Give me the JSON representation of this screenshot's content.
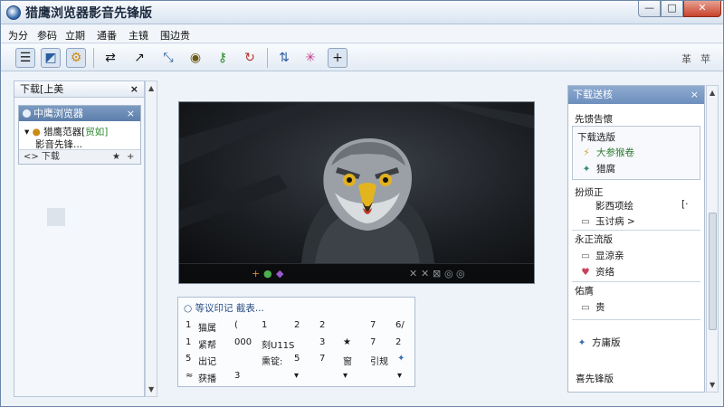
{
  "window": {
    "title": "猎鹰浏览器影音先锋版",
    "min": "—",
    "max": "□",
    "close": "✕"
  },
  "menu": [
    "为分",
    "参码",
    "立期",
    "通番",
    "主镜",
    "围边贵"
  ],
  "toolbar": {
    "icons": [
      "list-icon",
      "palette-icon",
      "folder-icon",
      "swap-icon",
      "line-icon",
      "resize-icon",
      "helmet-icon",
      "key-icon",
      "refresh-icon",
      "tools-icon",
      "star-burst-icon",
      "add-icon"
    ],
    "right_labels": [
      "革",
      "苹"
    ]
  },
  "left_panel": {
    "title": "下载[上美",
    "subpanel_title": "中鹰浏览器",
    "tree_root": "猎鹰范器[",
    "tree_root_suffix": "贸如]",
    "tree_child": "影音先锋...",
    "footer_label": "<> 下载",
    "footer_icons": [
      "★",
      "+"
    ]
  },
  "video": {
    "control_icons_left": [
      "+",
      "●",
      "◆"
    ],
    "control_icons_right": [
      "✕",
      "✕",
      "⊠",
      "◎",
      "◎"
    ]
  },
  "info_box": {
    "header": "○  等议印记    截表...",
    "rows": [
      [
        "1",
        "猫属",
        "(",
        "1",
        "2",
        "2",
        "",
        "7",
        "6/"
      ],
      [
        "1",
        "紧帮",
        "000",
        "刻U11S",
        "3",
        "★",
        "7",
        "2"
      ],
      [
        "5",
        "出记",
        "",
        "熏锭:",
        "5",
        "7",
        "窗",
        "引规",
        "✦"
      ],
      [
        "≈",
        "获播",
        "3",
        "",
        "▾",
        "",
        "▾",
        "",
        "▾"
      ]
    ]
  },
  "right_panel": {
    "title": "下载送核",
    "close": "×",
    "section1": "先馈告懷",
    "group1_title": "下载选版",
    "group1_items": [
      {
        "icon": "⚡",
        "label": "大参猴卷",
        "color": "#2f7a2f"
      },
      {
        "icon": "✦",
        "label": "猎腐"
      }
    ],
    "section2": "扮烦正",
    "section2_items": [
      {
        "icon": "",
        "label": "影西项绘",
        "suffix": "[·"
      },
      {
        "icon": "▭",
        "label": "玉讨病 >"
      }
    ],
    "section3": "永正流版",
    "section3_items": [
      {
        "icon": "▭",
        "label": "显涼亲"
      },
      {
        "icon": "♥",
        "label": "资络"
      }
    ],
    "section4": "佑膺",
    "section4_items": [
      {
        "icon": "▭",
        "label": "贵"
      }
    ],
    "bottom_items": [
      {
        "icon": "✦",
        "label": "方庸版"
      },
      {
        "icon": "",
        "label": "喜先锋版"
      }
    ]
  }
}
